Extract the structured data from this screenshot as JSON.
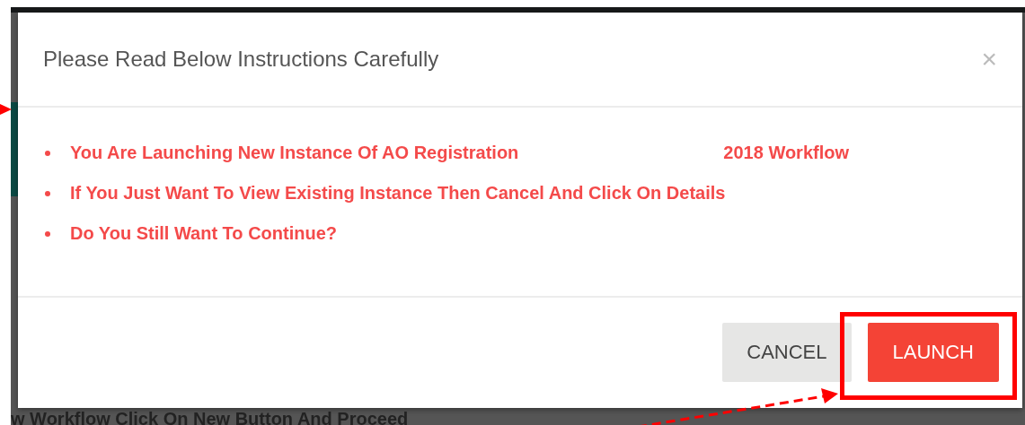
{
  "dialog": {
    "title": "Please Read Below Instructions Carefully",
    "close": "×",
    "items": [
      {
        "text": "You Are Launching New Instance Of AO Registration",
        "suffix": "2018 Workflow"
      },
      {
        "text": "If You Just Want To View Existing Instance Then Cancel And Click On Details"
      },
      {
        "text": "Do You Still Want To Continue?"
      }
    ],
    "buttons": [
      {
        "label": "CANCEL",
        "kind": "secondary"
      },
      {
        "label": "LAUNCH",
        "kind": "primary"
      }
    ]
  },
  "background_text": "w Workflow Click On New Button And Proceed"
}
